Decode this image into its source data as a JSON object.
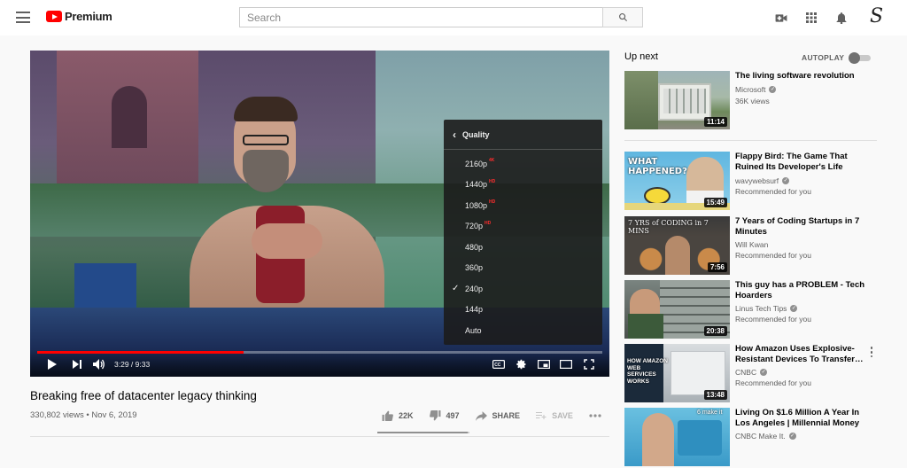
{
  "header": {
    "logo_text": "Premium",
    "search_placeholder": "Search",
    "avatar_letter": "S",
    "icons": [
      "menu-icon",
      "search-icon",
      "create-video-icon",
      "apps-grid-icon",
      "notifications-bell-icon"
    ]
  },
  "player": {
    "current_time": "3:29 / 9:33",
    "progress_fraction": 0.365,
    "quality_menu": {
      "title": "Quality",
      "selected": "240p",
      "options": [
        {
          "label": "2160p",
          "badge": "4K"
        },
        {
          "label": "1440p",
          "badge": "HD"
        },
        {
          "label": "1080p",
          "badge": "HD"
        },
        {
          "label": "720p",
          "badge": "HD"
        },
        {
          "label": "480p",
          "badge": ""
        },
        {
          "label": "360p",
          "badge": ""
        },
        {
          "label": "240p",
          "badge": ""
        },
        {
          "label": "144p",
          "badge": ""
        },
        {
          "label": "Auto",
          "badge": ""
        }
      ]
    },
    "accent_color": "#ff0000"
  },
  "video": {
    "title": "Breaking free of datacenter legacy thinking",
    "meta": "330,802 views • Nov 6, 2019",
    "likes": "22K",
    "dislikes": "497",
    "share_label": "SHARE",
    "save_label": "SAVE",
    "like_ratio": 0.978
  },
  "sidebar": {
    "up_next_label": "Up next",
    "autoplay_label": "AUTOPLAY",
    "autoplay_on": false,
    "items": [
      {
        "title": "The living software revolution",
        "channel": "Microsoft",
        "verified": true,
        "sub": "36K views",
        "duration": "11:14"
      },
      {
        "title": "Flappy Bird: The Game That Ruined Its Developer's Life",
        "channel": "wavywebsurf",
        "verified": true,
        "sub": "Recommended for you",
        "duration": "15:49",
        "thumb_text": "WHAT HAPPENED?"
      },
      {
        "title": "7 Years of Coding Startups in 7 Minutes",
        "channel": "Will Kwan",
        "verified": false,
        "sub": "Recommended for you",
        "duration": "7:56",
        "thumb_text": "7 YRS of CODING in 7 MINS"
      },
      {
        "title": "This guy has a PROBLEM - Tech Hoarders",
        "channel": "Linus Tech Tips",
        "verified": true,
        "sub": "Recommended for you",
        "duration": "20:38"
      },
      {
        "title": "How Amazon Uses Explosive-Resistant Devices To Transfer…",
        "channel": "CNBC",
        "verified": true,
        "sub": "Recommended for you",
        "duration": "13:48",
        "thumb_text": "HOW AMAZON WEB SERVICES WORKS"
      },
      {
        "title": "Living On $1.6 Million A Year In Los Angeles | Millennial Money",
        "channel": "CNBC Make It.",
        "verified": true,
        "sub": "",
        "duration": "",
        "thumb_text": "6 make it"
      }
    ]
  }
}
